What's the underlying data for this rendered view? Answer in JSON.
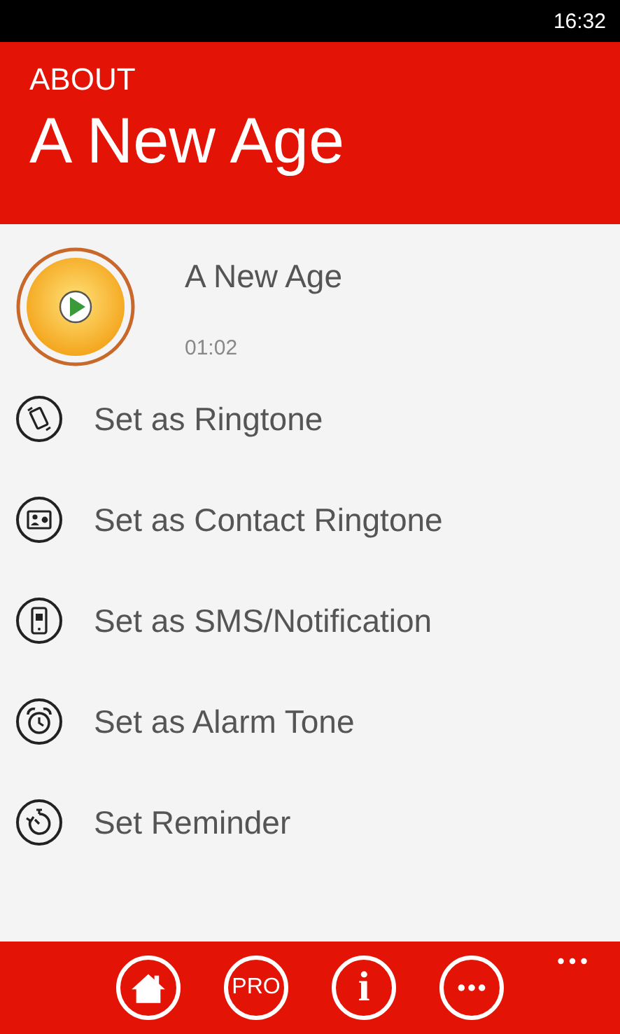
{
  "status_bar": {
    "time": "16:32"
  },
  "header": {
    "section": "ABOUT",
    "title": "A New Age"
  },
  "track": {
    "title": "A New Age",
    "duration": "01:02"
  },
  "actions": [
    {
      "kind": "ringtone",
      "label": "Set as Ringtone"
    },
    {
      "kind": "contact",
      "label": "Set as Contact Ringtone"
    },
    {
      "kind": "sms",
      "label": "Set as SMS/Notification"
    },
    {
      "kind": "alarm",
      "label": "Set as Alarm Tone"
    },
    {
      "kind": "reminder",
      "label": "Set Reminder"
    }
  ],
  "app_bar": {
    "buttons": [
      {
        "kind": "home"
      },
      {
        "kind": "text",
        "label": "PRO"
      },
      {
        "kind": "text",
        "label": "i"
      },
      {
        "kind": "dots"
      }
    ]
  }
}
